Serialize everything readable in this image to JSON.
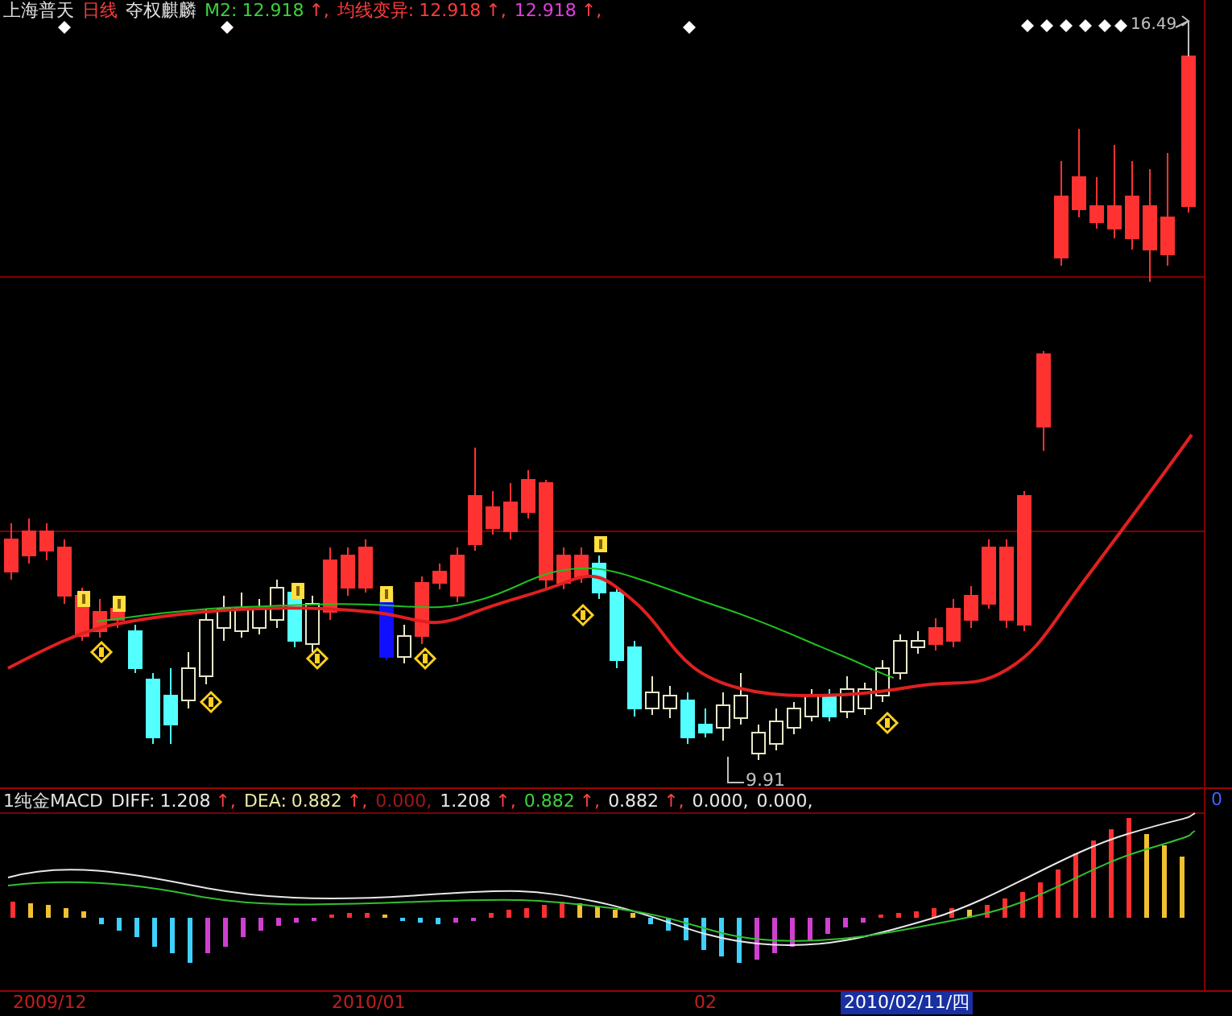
{
  "main_header": {
    "stock_name": "上海普天",
    "period": "日线",
    "indicator": "夺权麒麟",
    "values": [
      {
        "label": "M2:",
        "value": "12.918",
        "arrow": "↑,",
        "color": "#3cd23c"
      },
      {
        "label": "均线变异:",
        "value": "12.918",
        "arrow": "↑,",
        "color": "#ff3c3c"
      },
      {
        "value": "12.918",
        "arrow": "↑,",
        "color": "#e040e0"
      }
    ]
  },
  "price_labels": {
    "high": "16.49",
    "low": "9.91"
  },
  "macd_header": {
    "title": "1纯金MACD",
    "values": [
      {
        "label": "DIFF:",
        "value": "1.208",
        "arrow": "↑,",
        "color": "#e8e8e8"
      },
      {
        "label": "DEA:",
        "value": "0.882",
        "arrow": "↑,",
        "color": "#e8e8a0"
      },
      {
        "value": "0.000,",
        "color": "#a01818"
      },
      {
        "value": "1.208",
        "arrow": "↑,",
        "color": "#e8e8e8"
      },
      {
        "value": "0.882",
        "arrow": "↑,",
        "color": "#3cd23c"
      },
      {
        "value": "0.882",
        "arrow": "↑,",
        "color": "#e8e8e8"
      },
      {
        "value": "0.000,",
        "color": "#e8e8e8"
      },
      {
        "value": "0.000,",
        "color": "#e8e8e8"
      }
    ],
    "zero_label": "0"
  },
  "time_axis": {
    "labels": [
      "2009/12",
      "2010/01",
      "02"
    ],
    "cursor_date": "2010/02/11/四"
  }
}
